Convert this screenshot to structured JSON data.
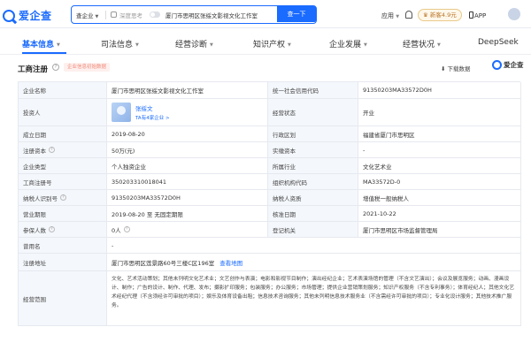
{
  "header": {
    "logo_text": "爱企查",
    "search_scope": "查企业",
    "deep_think_label": "深度思考",
    "search_query": "厦门市思明区张绥文影视文化工作室",
    "search_button": "查一下",
    "app_menu": "应用",
    "new_version_badge": "新客4.9元",
    "app_download": "APP"
  },
  "tabs": [
    {
      "label": "基本信息",
      "dropdown": true
    },
    {
      "label": "司法信息",
      "dropdown": true
    },
    {
      "label": "经营诊断",
      "dropdown": true
    },
    {
      "label": "知识产权",
      "dropdown": true
    },
    {
      "label": "企业发展",
      "dropdown": true
    },
    {
      "label": "经营状况",
      "dropdown": true
    },
    {
      "label": "DeepSeek",
      "dropdown": false
    }
  ],
  "section": {
    "title": "工商注册",
    "badge": "企业信息初始数据",
    "download": "下载数据",
    "watermark": "爱企查"
  },
  "table": {
    "rows": [
      {
        "l1": "企业名称",
        "v1": "厦门市思明区张绥文影视文化工作室",
        "l2": "统一社会信用代码",
        "v2": "91350203MA33572D0H"
      },
      {
        "l1": "投资人",
        "legal_name": "张绥文",
        "legal_sub": "TA有4家企业 >",
        "l2": "经营状态",
        "v2": "开业"
      },
      {
        "l1": "成立日期",
        "v1": "2019-08-20",
        "l2": "行政区划",
        "v2": "福建省厦门市思明区"
      },
      {
        "l1": "注册资本",
        "v1": "50万(元)",
        "l2": "实缴资本",
        "v2": "-"
      },
      {
        "l1": "企业类型",
        "v1": "个人独资企业",
        "l2": "所属行业",
        "v2": "文化艺术业"
      },
      {
        "l1": "工商注册号",
        "v1": "350203310018041",
        "l2": "组织机构代码",
        "v2": "MA33572D-0"
      },
      {
        "l1": "纳税人识别号",
        "v1": "91350203MA33572D0H",
        "l2": "纳税人资质",
        "v2": "增值税一般纳税人"
      },
      {
        "l1": "营业期限",
        "v1": "2019-08-20 至 无固定期限",
        "l2": "核准日期",
        "v2": "2021-10-22"
      },
      {
        "l1": "参保人数",
        "v1": "0人",
        "l2": "登记机关",
        "v2": "厦门市思明区市场监督管理局"
      },
      {
        "l1": "曾用名",
        "v1": "-"
      },
      {
        "l1": "注册地址",
        "v1": "厦门市思明区莲景路60号三楼C区196室",
        "link": "查看地图"
      },
      {
        "l1": "经营范围",
        "v1": "文化、艺术活动策划；其他未列明文化艺术业；文艺创作与表演；电影和影视节目制作；演出经纪企业；艺术表演场馆的管理（不含文艺演出）；会议及展览服务；动画、漫画设计、制作；广告的设计、制作、代理、发布；摄影扩印服务；包装服务；办公服务；市场管理；提供企业营销策划服务；知识产权服务（不含专利事务）；体育经纪人；其他文化艺术经纪代理（不含须经许可审批的项目）；娱乐及体育设备出租；信息技术咨询服务；其他未列明信息技术服务业（不含需经许可审批的项目）；专业化设计服务；其他技术推广服务。"
      }
    ]
  },
  "footer_watermark": "爱企查"
}
